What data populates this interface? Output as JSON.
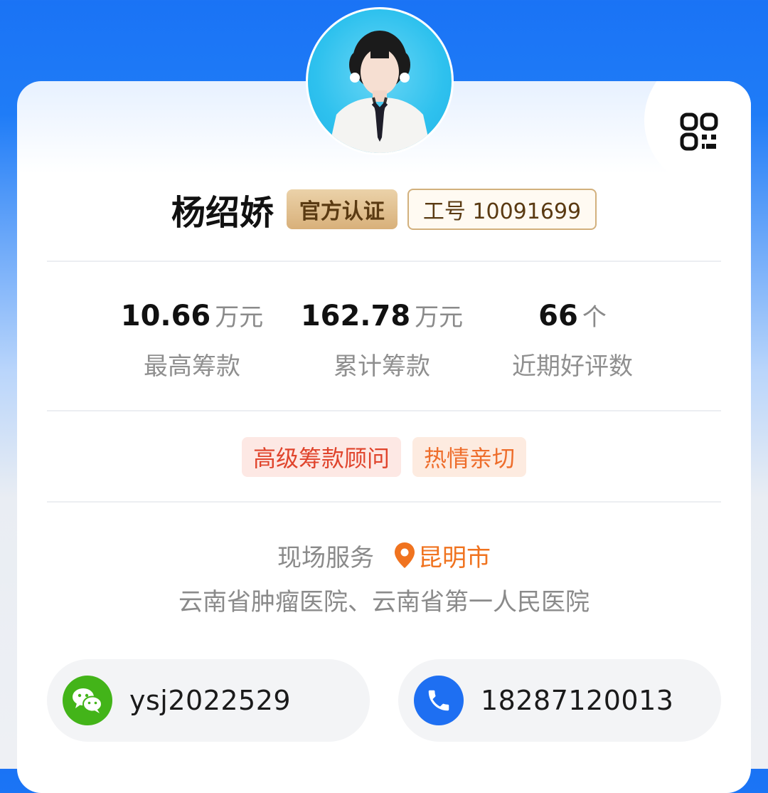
{
  "profile": {
    "name": "杨绍娇",
    "badge_official": "官方认证",
    "badge_id": "工号 10091699"
  },
  "stats": [
    {
      "value": "10.66",
      "unit": "万元",
      "label": "最高筹款"
    },
    {
      "value": "162.78",
      "unit": "万元",
      "label": "累计筹款"
    },
    {
      "value": "66",
      "unit": "个",
      "label": "近期好评数"
    }
  ],
  "tags": [
    {
      "label": "高级筹款顾问",
      "color": "#e0442c"
    },
    {
      "label": "热情亲切",
      "color": "#ee6d2b"
    }
  ],
  "service": {
    "label": "现场服务",
    "city": "昆明市",
    "hospitals": "云南省肿瘤医院、云南省第一人民医院"
  },
  "contact": {
    "wechat": "ysj2022529",
    "phone": "18287120013"
  },
  "icons": {
    "qr": "qr-code-icon",
    "location": "location-pin-icon",
    "wechat": "wechat-icon",
    "phone": "phone-icon"
  },
  "colors": {
    "header_blue": "#1a73f5",
    "wechat_green": "#43b419",
    "phone_blue": "#1e6ff2",
    "city_orange": "#f0731f",
    "gold": "#d8b07a"
  }
}
